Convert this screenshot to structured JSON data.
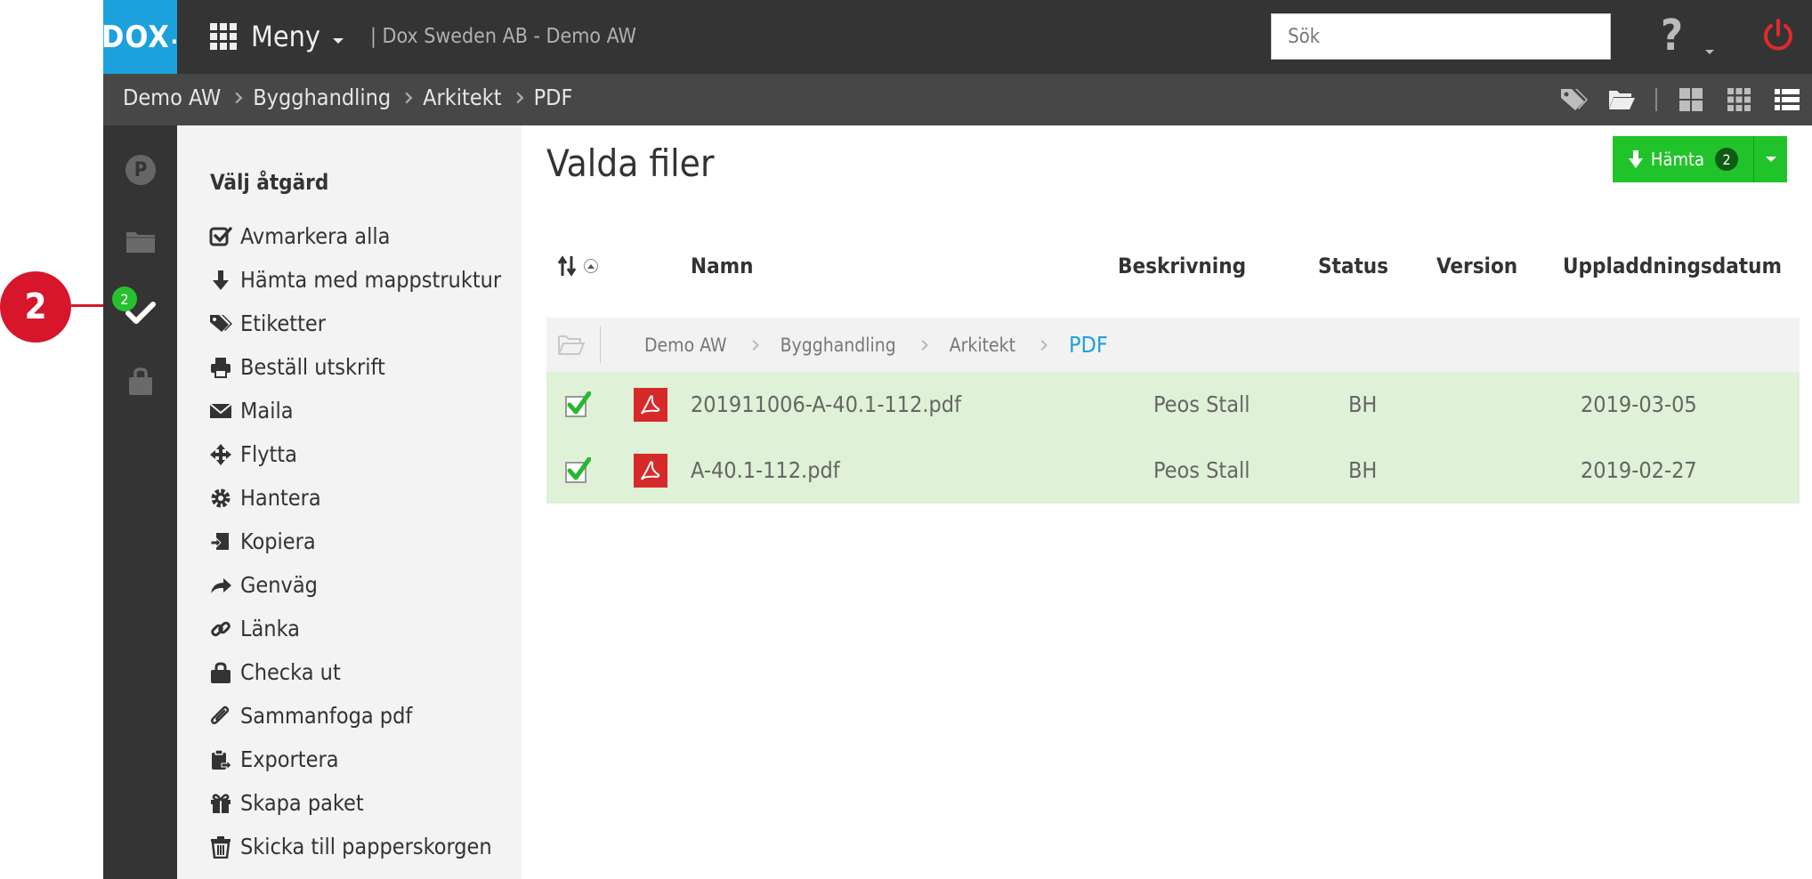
{
  "callout": {
    "number": "2"
  },
  "topbar": {
    "logo": "DOX",
    "menu_label": "Meny",
    "company": "| Dox Sweden AB - Demo AW",
    "search_placeholder": "Sök",
    "help_label": "?"
  },
  "breadcrumb": {
    "items": [
      "Demo AW",
      "Bygghandling",
      "Arkitekt",
      "PDF"
    ]
  },
  "rail": {
    "badge_count": "2",
    "p_label": "P"
  },
  "actions": {
    "title": "Välj åtgärd",
    "items": [
      {
        "label": "Avmarkera alla",
        "icon": "check-square-icon"
      },
      {
        "label": "Hämta med mappstruktur",
        "icon": "arrow-down-icon"
      },
      {
        "label": "Etiketter",
        "icon": "tags-icon"
      },
      {
        "label": "Beställ utskrift",
        "icon": "printer-icon"
      },
      {
        "label": "Maila",
        "icon": "envelope-icon"
      },
      {
        "label": "Flytta",
        "icon": "move-icon"
      },
      {
        "label": "Hantera",
        "icon": "gear-icon"
      },
      {
        "label": "Kopiera",
        "icon": "copy-icon"
      },
      {
        "label": "Genväg",
        "icon": "share-arrow-icon"
      },
      {
        "label": "Länka",
        "icon": "link-icon"
      },
      {
        "label": "Checka ut",
        "icon": "lock-icon"
      },
      {
        "label": "Sammanfoga pdf",
        "icon": "paperclip-icon"
      },
      {
        "label": "Exportera",
        "icon": "clipboard-export-icon"
      },
      {
        "label": "Skapa paket",
        "icon": "gift-icon"
      },
      {
        "label": "Skicka till papperskorgen",
        "icon": "trash-icon"
      }
    ]
  },
  "main": {
    "title": "Valda filer",
    "download": {
      "label": "Hämta",
      "count": "2"
    },
    "columns": {
      "name": "Namn",
      "description": "Beskrivning",
      "status": "Status",
      "version": "Version",
      "upload_date": "Uppladdningsdatum"
    },
    "path": [
      "Demo AW",
      "Bygghandling",
      "Arkitekt",
      "PDF"
    ],
    "files": [
      {
        "name": "201911006-A-40.1-112.pdf",
        "description": "Peos Stall",
        "status": "BH",
        "version": "",
        "date": "2019-03-05"
      },
      {
        "name": "A-40.1-112.pdf",
        "description": "Peos Stall",
        "status": "BH",
        "version": "",
        "date": "2019-02-27"
      }
    ]
  },
  "colors": {
    "topbar": "#343434",
    "crumbbar": "#474747",
    "logo": "#1da1dd",
    "accent_green": "#21c32a",
    "selected_row": "#dff1d6",
    "callout_red": "#d7152b",
    "pdf_red": "#d62a2a"
  }
}
